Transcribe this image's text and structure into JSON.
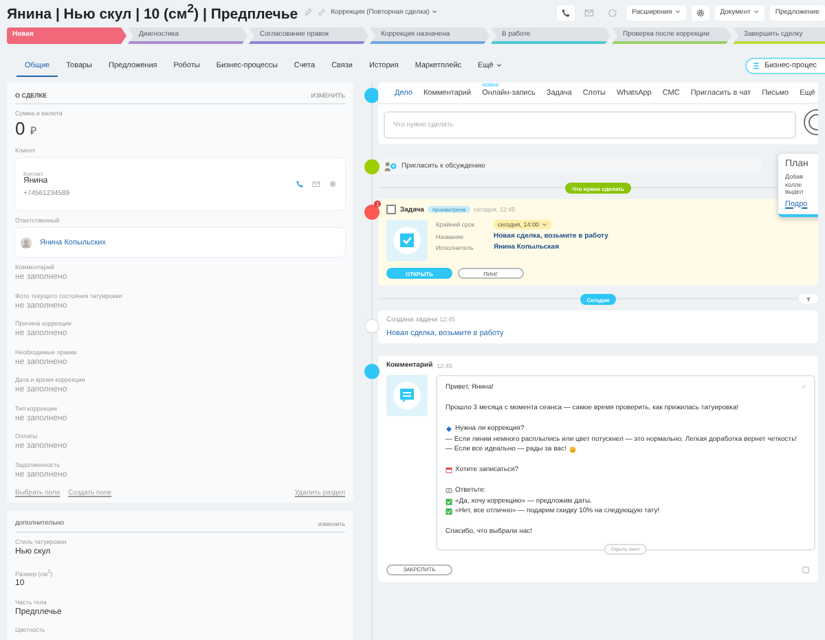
{
  "header": {
    "title": "Янина | Нью скул | 10 (см$^{2}$) | Предплечье",
    "category": "Коррекция (Повторная сделка)",
    "buttons": [
      {
        "label": "Расширения",
        "caret": true
      },
      {
        "label": "Документ",
        "caret": true
      },
      {
        "label": "Предложение",
        "caret": false
      }
    ]
  },
  "stages": [
    {
      "label": "Новая",
      "color": "#f0687a",
      "selected": true
    },
    {
      "label": "Диагностика",
      "color": "#a98bd3",
      "selected": false
    },
    {
      "label": "Согласование правок",
      "color": "#8c84d8",
      "selected": false
    },
    {
      "label": "Коррекция назначена",
      "color": "#6ea8e2",
      "selected": false
    },
    {
      "label": "В работе",
      "color": "#4ec7d2",
      "selected": false
    },
    {
      "label": "Проверка после коррекции",
      "color": "#9dd06c",
      "selected": false
    },
    {
      "label": "Завершить сделку",
      "color": "#b8dc3a",
      "selected": false
    }
  ],
  "tabs": [
    {
      "label": "Общие",
      "selected": true
    },
    {
      "label": "Товары",
      "selected": false
    },
    {
      "label": "Предложения",
      "selected": false
    },
    {
      "label": "Роботы",
      "selected": false
    },
    {
      "label": "Бизнес-процессы",
      "selected": false
    },
    {
      "label": "Счета",
      "selected": false
    },
    {
      "label": "Связи",
      "selected": false
    },
    {
      "label": "История",
      "selected": false
    },
    {
      "label": "Маркетплейс",
      "selected": false
    },
    {
      "label": "Ещё",
      "selected": false
    }
  ],
  "bp_button": "Бизнес-процес",
  "deal_card": {
    "title": "О СДЕЛКЕ",
    "edit": "ИЗМЕНИТЬ",
    "amount_label": "Сумма и валюта",
    "amount": "0",
    "currency": "₽",
    "client_label": "Клиент",
    "contact_label": "Контакт",
    "contact_name": "Янина",
    "contact_phone": "+74561234589",
    "responsible_label": "Ответственный",
    "responsible": "Янина Копыльских",
    "fields": [
      {
        "label": "Комментарий",
        "value": "не заполнено"
      },
      {
        "label": "Фото текущего состояния татуировки",
        "value": "не заполнено"
      },
      {
        "label": "Причина коррекции",
        "value": "не заполнено"
      },
      {
        "label": "Необходимые правки",
        "value": "не заполнено"
      },
      {
        "label": "Дата и время коррекции",
        "value": "не заполнено"
      },
      {
        "label": "Тип коррекции",
        "value": "не заполнено"
      },
      {
        "label": "Оплаты",
        "value": "не заполнено"
      },
      {
        "label": "Задолженность",
        "value": "не заполнено"
      }
    ],
    "links": [
      "Выбрать поле",
      "Создать поле"
    ],
    "delete_link": "Удалить раздел"
  },
  "extra_card": {
    "title": "дополнительно",
    "edit": "изменить",
    "fields": [
      {
        "label": "Стиль татуировки",
        "value": "Нью скул"
      },
      {
        "label": "Размер (см$^{2}$)",
        "value": "10"
      },
      {
        "label": "Часть тела",
        "value": "Предплечье"
      },
      {
        "label": "Цветность"
      }
    ]
  },
  "composer": {
    "tabs": [
      {
        "label": "Дело",
        "selected": true
      },
      {
        "label": "Комментарий",
        "selected": false
      },
      {
        "label": "Онлайн-запись",
        "selected": false,
        "badge": "новое"
      },
      {
        "label": "Задача",
        "selected": false
      },
      {
        "label": "Слоты",
        "selected": false
      },
      {
        "label": "WhatsApp",
        "selected": false
      },
      {
        "label": "СМС",
        "selected": false
      },
      {
        "label": "Пригласить в чат",
        "selected": false
      },
      {
        "label": "Письмо",
        "selected": false
      },
      {
        "label": "Ещё",
        "selected": false
      }
    ],
    "placeholder": "Что нужно сделать"
  },
  "popup": {
    "title": "План",
    "lines": [
      "Добав",
      "колле",
      "выдел"
    ],
    "link": "Подро"
  },
  "invite": "Пригласить к обсуждению",
  "todo_pill": "Что нужно сделать",
  "task": {
    "checked": false,
    "title": "Задача",
    "badge": "просмотрена",
    "time": "сегодня, 12:45",
    "counter": "1",
    "deadline_label": "Крайний срок",
    "deadline": "сегодня, 14:00",
    "name_label": "Название",
    "name": "Новая сделка, возьмите в работу",
    "executor_label": "Исполнитель",
    "executor": "Янина Копыльская",
    "open_button": "ОТКРЫТЬ",
    "ping_button": "ПИНГ"
  },
  "today_pill": "Сегодня",
  "created": {
    "title": "Создана задача",
    "time": "12:45",
    "link": "Новая сделка, возьмите в работу"
  },
  "comment": {
    "title": "Комментарий",
    "time": "12:45",
    "lines": [
      {
        "kind": "text",
        "text": "Привет, Янина!"
      },
      {
        "kind": "gap"
      },
      {
        "kind": "text",
        "text": "Прошло 3 месяца с момента сеанса — самое время проверить, как прижилась татуировка!"
      },
      {
        "kind": "gap"
      },
      {
        "kind": "question",
        "text": "Нужна ли коррекция?"
      },
      {
        "kind": "text",
        "text": "— Если линии немного расплылись или цвет потускнел — это нормально. Легкая доработка вернет четкость!"
      },
      {
        "kind": "smile",
        "text": "— Если все идеально — рады за вас!"
      },
      {
        "kind": "gap"
      },
      {
        "kind": "calendar",
        "text": "Хотите записаться?"
      },
      {
        "kind": "gap"
      },
      {
        "kind": "reply",
        "text": "Ответьте:"
      },
      {
        "kind": "check",
        "text": "«Да, хочу коррекцию» — предложим даты."
      },
      {
        "kind": "check",
        "text": "«Нет, все отлично» — подарим скидку 10% на следующую тату!"
      },
      {
        "kind": "gap"
      },
      {
        "kind": "text",
        "text": "Спасибо, что выбрали нас!"
      }
    ],
    "hide": "Скрыть текст",
    "pin": "ЗАКРЕПИТЬ"
  }
}
